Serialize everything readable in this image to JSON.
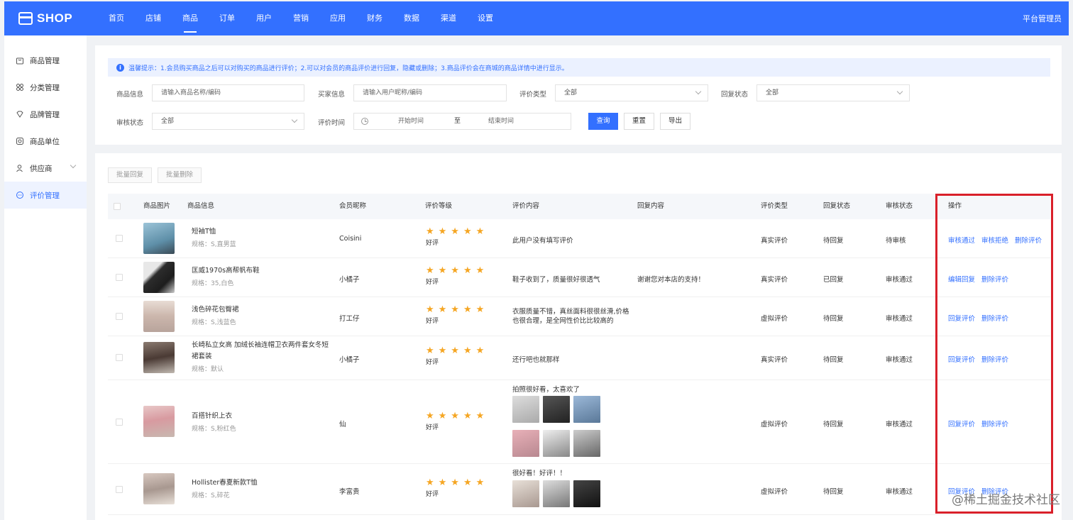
{
  "app": {
    "logo_text": "SHOP",
    "admin_label": "平台管理员"
  },
  "nav": [
    "首页",
    "店铺",
    "商品",
    "订单",
    "用户",
    "营销",
    "应用",
    "财务",
    "数据",
    "渠道",
    "设置"
  ],
  "nav_active_index": 2,
  "sidebar": {
    "items": [
      {
        "label": "商品管理",
        "icon": "bag-icon"
      },
      {
        "label": "分类管理",
        "icon": "grid-icon"
      },
      {
        "label": "品牌管理",
        "icon": "diamond-icon"
      },
      {
        "label": "商品单位",
        "icon": "target-icon"
      },
      {
        "label": "供应商",
        "icon": "user-icon",
        "has_arrow": true
      },
      {
        "label": "评价管理",
        "icon": "chat-icon",
        "active": true
      }
    ]
  },
  "tip": {
    "text": "温馨提示：1.会员购买商品之后可以对购买的商品进行评价；2.可以对会员的商品评价进行回复，隐藏或删除；3.商品评价会在商城的商品详情中进行显示。"
  },
  "filters": {
    "product_info_label": "商品信息",
    "product_info_placeholder": "请输入商品名称/编码",
    "buyer_info_label": "买家信息",
    "buyer_info_placeholder": "请输入用户昵称/编码",
    "review_type_label": "评价类型",
    "review_type_value": "全部",
    "reply_status_label": "回复状态",
    "reply_status_value": "全部",
    "audit_status_label": "审核状态",
    "audit_status_value": "全部",
    "review_time_label": "评价时间",
    "start_time_placeholder": "开始时间",
    "range_separator": "至",
    "end_time_placeholder": "结束时间",
    "query_button": "查询",
    "reset_button": "重置",
    "export_button": "导出"
  },
  "bulk": {
    "reply": "批量回复",
    "delete": "批量删除"
  },
  "table": {
    "headers": {
      "image": "商品图片",
      "info": "商品信息",
      "member": "会员昵称",
      "rating": "评价等级",
      "content": "评价内容",
      "reply": "回复内容",
      "type": "评价类型",
      "reply_status": "回复状态",
      "audit_status": "审核状态",
      "actions": "操作"
    },
    "rows": [
      {
        "name": "短袖T恤",
        "spec": "规格：S,直男蓝",
        "member": "Coisini",
        "stars": "★★★★★",
        "rating": "好评",
        "content": "此用户没有填写评价",
        "reply": "",
        "type": "真实评价",
        "reply_status": "待回复",
        "audit_status": "待审核",
        "actions": [
          "审核通过",
          "审核拒绝",
          "删除评价"
        ],
        "thumb_color": "#7aa7c0"
      },
      {
        "name": "匡威1970s高帮帆布鞋",
        "spec": "规格：35,白色",
        "member": "小橘子",
        "stars": "★★★★★",
        "rating": "好评",
        "content": "鞋子收到了，质量很好很透气",
        "reply": "谢谢您对本店的支持！",
        "type": "真实评价",
        "reply_status": "已回复",
        "audit_status": "审核通过",
        "actions": [
          "编辑回复",
          "删除评价"
        ],
        "thumb_color": "#3b3b3b"
      },
      {
        "name": "浅色碎花包臀裙",
        "spec": "规格：S,浅蓝色",
        "member": "打工仔",
        "stars": "★★★★★",
        "rating": "好评",
        "content_line1": "衣服质量不错，真丝面料很很丝滑,价格",
        "content_line2": "也很合理，是全网性价比比较高的",
        "reply": "",
        "type": "虚拟评价",
        "reply_status": "待回复",
        "audit_status": "审核通过",
        "actions": [
          "回复评价",
          "删除评价"
        ],
        "thumb_color": "#d9c8c0"
      },
      {
        "name_line1": "长崎私立女高 加绒长袖连帽卫衣两件套女冬短",
        "name_line2": "裙套装",
        "spec": "规格：默认",
        "member": "小橘子",
        "stars": "★★★★★",
        "rating": "好评",
        "content": "还行吧也就那样",
        "reply": "",
        "type": "真实评价",
        "reply_status": "待回复",
        "audit_status": "审核通过",
        "actions": [
          "回复评价",
          "删除评价"
        ],
        "thumb_color": "#5a4a44"
      },
      {
        "name": "百搭针织上衣",
        "spec": "规格：S,粉红色",
        "member": "仙",
        "stars": "★★★★★",
        "rating": "好评",
        "content": "拍照很好看，太喜欢了",
        "reply": "",
        "type": "虚拟评价",
        "reply_status": "待回复",
        "audit_status": "审核通过",
        "actions": [
          "回复评价",
          "删除评价"
        ],
        "thumb_color": "#d9a0a8"
      },
      {
        "name": "Hollister春夏新款T恤",
        "spec": "规格：S,碎花",
        "member": "李富贵",
        "stars": "★★★★★",
        "rating": "好评",
        "content": "很好看！好评！！",
        "reply": "",
        "type": "虚拟评价",
        "reply_status": "待回复",
        "audit_status": "审核通过",
        "actions": [
          "回复评价",
          "删除评价"
        ],
        "thumb_color": "#c8b8b0"
      }
    ]
  },
  "watermark": "@稀土掘金技术社区",
  "colors": {
    "primary": "#3370ff",
    "highlight_border": "#d9202a",
    "star": "#f5a623"
  }
}
